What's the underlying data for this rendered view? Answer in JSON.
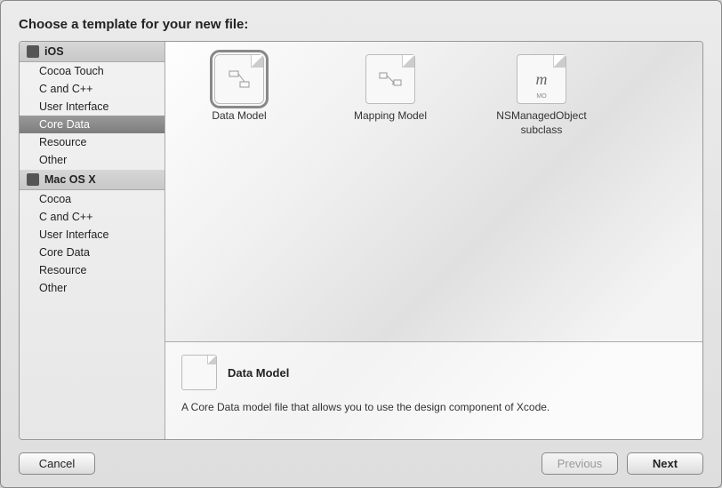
{
  "dialog": {
    "title": "Choose a template for your new file:"
  },
  "sidebar": {
    "sections": [
      {
        "label": "iOS",
        "items": [
          {
            "label": "Cocoa Touch",
            "selected": false
          },
          {
            "label": "C and C++",
            "selected": false
          },
          {
            "label": "User Interface",
            "selected": false
          },
          {
            "label": "Core Data",
            "selected": true
          },
          {
            "label": "Resource",
            "selected": false
          },
          {
            "label": "Other",
            "selected": false
          }
        ]
      },
      {
        "label": "Mac OS X",
        "items": [
          {
            "label": "Cocoa",
            "selected": false
          },
          {
            "label": "C and C++",
            "selected": false
          },
          {
            "label": "User Interface",
            "selected": false
          },
          {
            "label": "Core Data",
            "selected": false
          },
          {
            "label": "Resource",
            "selected": false
          },
          {
            "label": "Other",
            "selected": false
          }
        ]
      }
    ]
  },
  "templates": [
    {
      "label": "Data Model",
      "selected": true,
      "iconHint": ""
    },
    {
      "label": "Mapping Model",
      "selected": false,
      "iconHint": ""
    },
    {
      "label": "NSManagedObject subclass",
      "selected": false,
      "iconHint": "m"
    }
  ],
  "detail": {
    "title": "Data Model",
    "description": "A Core Data model file that allows you to use the design component of Xcode."
  },
  "buttons": {
    "cancel": "Cancel",
    "previous": "Previous",
    "next": "Next"
  }
}
